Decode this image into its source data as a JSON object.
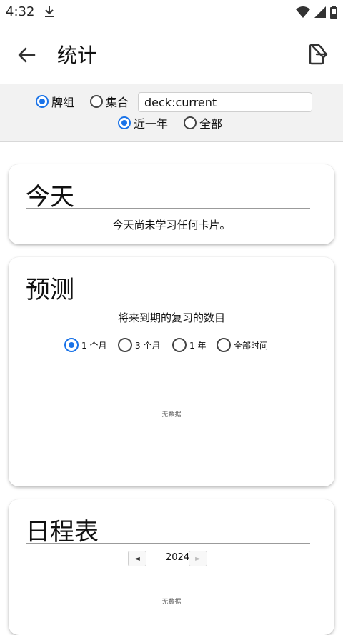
{
  "status": {
    "time": "4:32"
  },
  "appbar": {
    "title": "统计"
  },
  "filter": {
    "options": [
      "牌组",
      "集合"
    ],
    "selected": "牌组",
    "search_value": "deck:current",
    "range_options": [
      "近一年",
      "全部"
    ],
    "range_selected": "近一年"
  },
  "today": {
    "title": "今天",
    "message": "今天尚未学习任何卡片。"
  },
  "forecast": {
    "title": "预测",
    "subtitle": "将来到期的复习的数目",
    "ranges": [
      "1 个月",
      "3 个月",
      "1 年",
      "全部时间"
    ],
    "selected": "1 个月",
    "nodata": "无数据"
  },
  "calendar": {
    "title": "日程表",
    "prev": "◄",
    "year": "2024",
    "next": "►",
    "nodata": "无数据"
  },
  "colors": {
    "accent": "#1a73e8",
    "card_bg": "#ffffff",
    "controls_bg": "#f2f2f2"
  }
}
